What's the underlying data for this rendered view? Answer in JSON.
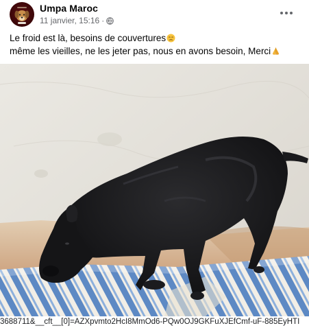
{
  "post": {
    "author": "Umpa Maroc",
    "timestamp": "11 janvier, 15:16",
    "separator": "·",
    "privacy_icon": "globe-icon",
    "more_icon": "more-options-icon",
    "text_line_1": "Le froid est là, besoins de couvertures",
    "emoji_1": "sad-face-emoji",
    "text_line_2": "même les vieilles, ne les jeter pas, nous en avons besoin, Merci",
    "emoji_2": "praying-hands-emoji"
  },
  "photo": {
    "subject": "black dog lying on a striped blanket against a white wall"
  },
  "status_bar": {
    "url_text": "3688711&__cft__[0]=AZXpvmto2HcI8MmOd6-PQw0OJ9GKFuXJEfCmf-uF-885EyHTI"
  },
  "colors": {
    "author_text": "#050505",
    "meta_text": "#65676b",
    "avatar_bg": "#4a0a0d",
    "wall": "#e4e2dc",
    "dog": "#1c1c1e",
    "blanket_blue": "#5a86c2"
  }
}
